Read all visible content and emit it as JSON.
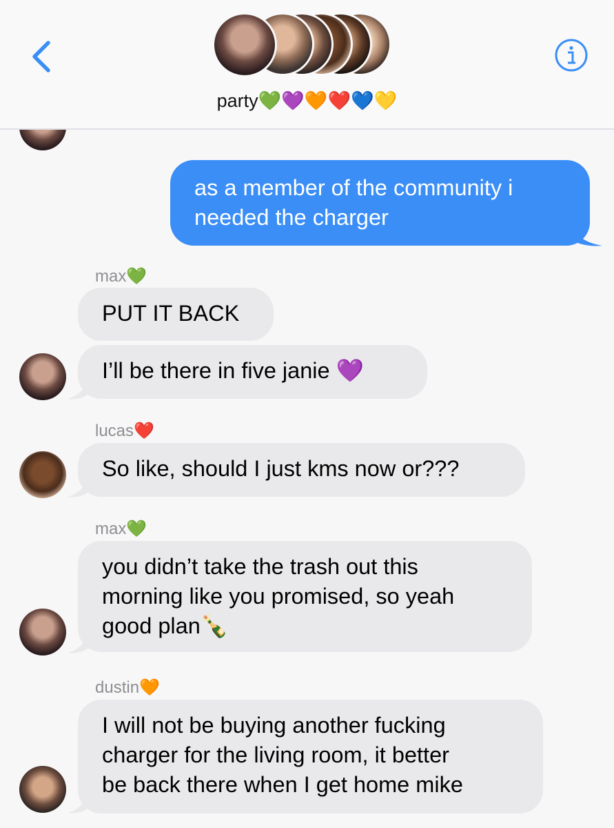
{
  "header": {
    "group_name": "party",
    "group_hearts": "💚💜🧡❤️💙💛",
    "back_icon": "chevron-left-icon",
    "info_icon": "info-icon",
    "accent_color": "#3a8ef6"
  },
  "messages": {
    "m1": {
      "text_line1": "as a member of the community i",
      "text_line2": "needed the charger"
    },
    "max1": {
      "sender": "max💚",
      "text": "PUT IT BACK"
    },
    "max2": {
      "text": "I’ll be there in five janie 💜"
    },
    "lucas1": {
      "sender": "lucas❤️",
      "text": "So like, should I just kms now or???"
    },
    "max3": {
      "sender": "max💚",
      "line1": "you didn’t take the trash out this",
      "line2": "morning like you promised, so yeah",
      "line3": "good plan🍾"
    },
    "dustin1": {
      "sender": "dustin🧡",
      "line1": "I will not be buying another fucking",
      "line2": "charger for the living room, it better",
      "line3": "be back there when I get home mike"
    }
  }
}
